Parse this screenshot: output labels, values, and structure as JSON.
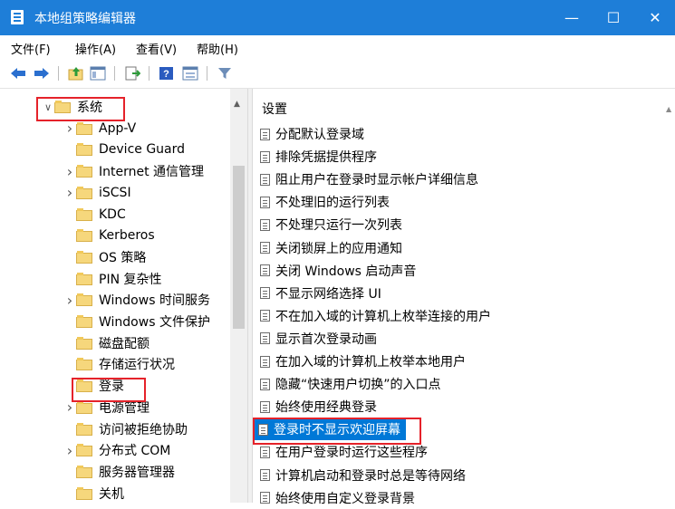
{
  "window": {
    "title": "本地组策略编辑器",
    "minimize": "—",
    "maximize": "☐",
    "close": "✕"
  },
  "menu": [
    "文件(F)",
    "操作(A)",
    "查看(V)",
    "帮助(H)"
  ],
  "toolbar_icons": [
    "back-arrow-icon",
    "forward-arrow-icon",
    "up-folder-icon",
    "console-tree-icon",
    "export-list-icon",
    "help-icon",
    "properties-icon",
    "filter-icon"
  ],
  "tree": {
    "items": [
      {
        "label": "系统",
        "expand": "expanded"
      },
      {
        "label": "App-V",
        "expand": "collapsed"
      },
      {
        "label": "Device Guard",
        "expand": ""
      },
      {
        "label": "Internet 通信管理",
        "expand": "collapsed"
      },
      {
        "label": "iSCSI",
        "expand": "collapsed"
      },
      {
        "label": "KDC",
        "expand": ""
      },
      {
        "label": "Kerberos",
        "expand": ""
      },
      {
        "label": "OS 策略",
        "expand": ""
      },
      {
        "label": "PIN 复杂性",
        "expand": ""
      },
      {
        "label": "Windows 时间服务",
        "expand": "collapsed"
      },
      {
        "label": "Windows 文件保护",
        "expand": ""
      },
      {
        "label": "磁盘配额",
        "expand": ""
      },
      {
        "label": "存储运行状况",
        "expand": ""
      },
      {
        "label": "登录",
        "expand": ""
      },
      {
        "label": "电源管理",
        "expand": "collapsed"
      },
      {
        "label": "访问被拒绝协助",
        "expand": ""
      },
      {
        "label": "分布式 COM",
        "expand": "collapsed"
      },
      {
        "label": "服务器管理器",
        "expand": ""
      },
      {
        "label": "关机",
        "expand": ""
      }
    ]
  },
  "settings": {
    "header": "设置",
    "items": [
      "分配默认登录域",
      "排除凭据提供程序",
      "阻止用户在登录时显示帐户详细信息",
      "不处理旧的运行列表",
      "不处理只运行一次列表",
      "关闭锁屏上的应用通知",
      "关闭 Windows 启动声音",
      "不显示网络选择 UI",
      "不在加入域的计算机上枚举连接的用户",
      "显示首次登录动画",
      "在加入域的计算机上枚举本地用户",
      "隐藏“快速用户切换”的入口点",
      "始终使用经典登录",
      "登录时不显示欢迎屏幕",
      "在用户登录时运行这些程序",
      "计算机启动和登录时总是等待网络",
      "始终使用自定义登录背景"
    ],
    "selected": "登录时不显示欢迎屏幕"
  },
  "colors": {
    "titlebar": "#1e7ed8",
    "selection": "#0078d7",
    "highlight_box": "#e5222a",
    "folder": "#f6d77c"
  }
}
